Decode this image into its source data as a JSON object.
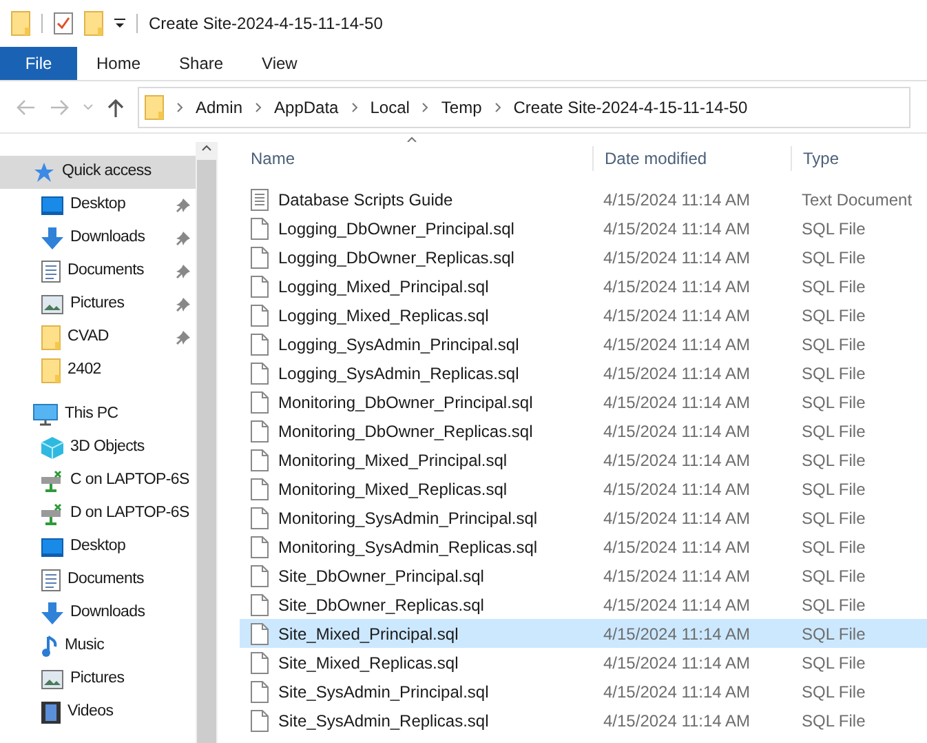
{
  "window": {
    "title": "Create Site-2024-4-15-11-14-50"
  },
  "ribbon_tabs": [
    {
      "label": "File",
      "selected": true
    },
    {
      "label": "Home",
      "selected": false
    },
    {
      "label": "Share",
      "selected": false
    },
    {
      "label": "View",
      "selected": false
    }
  ],
  "address_bar": {
    "path": [
      "Admin",
      "AppData",
      "Local",
      "Temp",
      "Create Site-2024-4-15-11-14-50"
    ]
  },
  "sidebar": {
    "items": [
      {
        "label": "Quick access",
        "kind": "star",
        "selected": true,
        "children": [
          {
            "label": "Desktop",
            "kind": "desktop",
            "selected": false,
            "pinned": true
          },
          {
            "label": "Downloads",
            "kind": "download",
            "selected": false,
            "pinned": true
          },
          {
            "label": "Documents",
            "kind": "document",
            "selected": false,
            "pinned": true
          },
          {
            "label": "Pictures",
            "kind": "picture",
            "selected": false,
            "pinned": true
          },
          {
            "label": "CVAD",
            "kind": "folder",
            "selected": false,
            "pinned": true
          },
          {
            "label": "2402",
            "kind": "folder",
            "selected": false,
            "pinned": false
          }
        ]
      },
      {
        "label": "This PC",
        "kind": "pc",
        "selected": false,
        "children": [
          {
            "label": "3D Objects",
            "kind": "cube",
            "selected": false
          },
          {
            "label": "C on LAPTOP-6S",
            "kind": "drive",
            "selected": false
          },
          {
            "label": "D on LAPTOP-6S",
            "kind": "drive",
            "selected": false
          },
          {
            "label": "Desktop",
            "kind": "desktop",
            "selected": false
          },
          {
            "label": "Documents",
            "kind": "document",
            "selected": false
          },
          {
            "label": "Downloads",
            "kind": "download",
            "selected": false
          },
          {
            "label": "Music",
            "kind": "music",
            "selected": false
          },
          {
            "label": "Pictures",
            "kind": "picture",
            "selected": false
          },
          {
            "label": "Videos",
            "kind": "video",
            "selected": false
          }
        ]
      }
    ]
  },
  "table": {
    "columns": [
      "Name",
      "Date modified",
      "Type"
    ],
    "rows": [
      {
        "name": "Database Scripts Guide",
        "date": "4/15/2024 11:14 AM",
        "type": "Text Document",
        "kind": "text",
        "selected": false
      },
      {
        "name": "Logging_DbOwner_Principal.sql",
        "date": "4/15/2024 11:14 AM",
        "type": "SQL File",
        "kind": "sql",
        "selected": false
      },
      {
        "name": "Logging_DbOwner_Replicas.sql",
        "date": "4/15/2024 11:14 AM",
        "type": "SQL File",
        "kind": "sql",
        "selected": false
      },
      {
        "name": "Logging_Mixed_Principal.sql",
        "date": "4/15/2024 11:14 AM",
        "type": "SQL File",
        "kind": "sql",
        "selected": false
      },
      {
        "name": "Logging_Mixed_Replicas.sql",
        "date": "4/15/2024 11:14 AM",
        "type": "SQL File",
        "kind": "sql",
        "selected": false
      },
      {
        "name": "Logging_SysAdmin_Principal.sql",
        "date": "4/15/2024 11:14 AM",
        "type": "SQL File",
        "kind": "sql",
        "selected": false
      },
      {
        "name": "Logging_SysAdmin_Replicas.sql",
        "date": "4/15/2024 11:14 AM",
        "type": "SQL File",
        "kind": "sql",
        "selected": false
      },
      {
        "name": "Monitoring_DbOwner_Principal.sql",
        "date": "4/15/2024 11:14 AM",
        "type": "SQL File",
        "kind": "sql",
        "selected": false
      },
      {
        "name": "Monitoring_DbOwner_Replicas.sql",
        "date": "4/15/2024 11:14 AM",
        "type": "SQL File",
        "kind": "sql",
        "selected": false
      },
      {
        "name": "Monitoring_Mixed_Principal.sql",
        "date": "4/15/2024 11:14 AM",
        "type": "SQL File",
        "kind": "sql",
        "selected": false
      },
      {
        "name": "Monitoring_Mixed_Replicas.sql",
        "date": "4/15/2024 11:14 AM",
        "type": "SQL File",
        "kind": "sql",
        "selected": false
      },
      {
        "name": "Monitoring_SysAdmin_Principal.sql",
        "date": "4/15/2024 11:14 AM",
        "type": "SQL File",
        "kind": "sql",
        "selected": false
      },
      {
        "name": "Monitoring_SysAdmin_Replicas.sql",
        "date": "4/15/2024 11:14 AM",
        "type": "SQL File",
        "kind": "sql",
        "selected": false
      },
      {
        "name": "Site_DbOwner_Principal.sql",
        "date": "4/15/2024 11:14 AM",
        "type": "SQL File",
        "kind": "sql",
        "selected": false
      },
      {
        "name": "Site_DbOwner_Replicas.sql",
        "date": "4/15/2024 11:14 AM",
        "type": "SQL File",
        "kind": "sql",
        "selected": false
      },
      {
        "name": "Site_Mixed_Principal.sql",
        "date": "4/15/2024 11:14 AM",
        "type": "SQL File",
        "kind": "sql",
        "selected": true
      },
      {
        "name": "Site_Mixed_Replicas.sql",
        "date": "4/15/2024 11:14 AM",
        "type": "SQL File",
        "kind": "sql",
        "selected": false
      },
      {
        "name": "Site_SysAdmin_Principal.sql",
        "date": "4/15/2024 11:14 AM",
        "type": "SQL File",
        "kind": "sql",
        "selected": false
      },
      {
        "name": "Site_SysAdmin_Replicas.sql",
        "date": "4/15/2024 11:14 AM",
        "type": "SQL File",
        "kind": "sql",
        "selected": false
      }
    ]
  }
}
